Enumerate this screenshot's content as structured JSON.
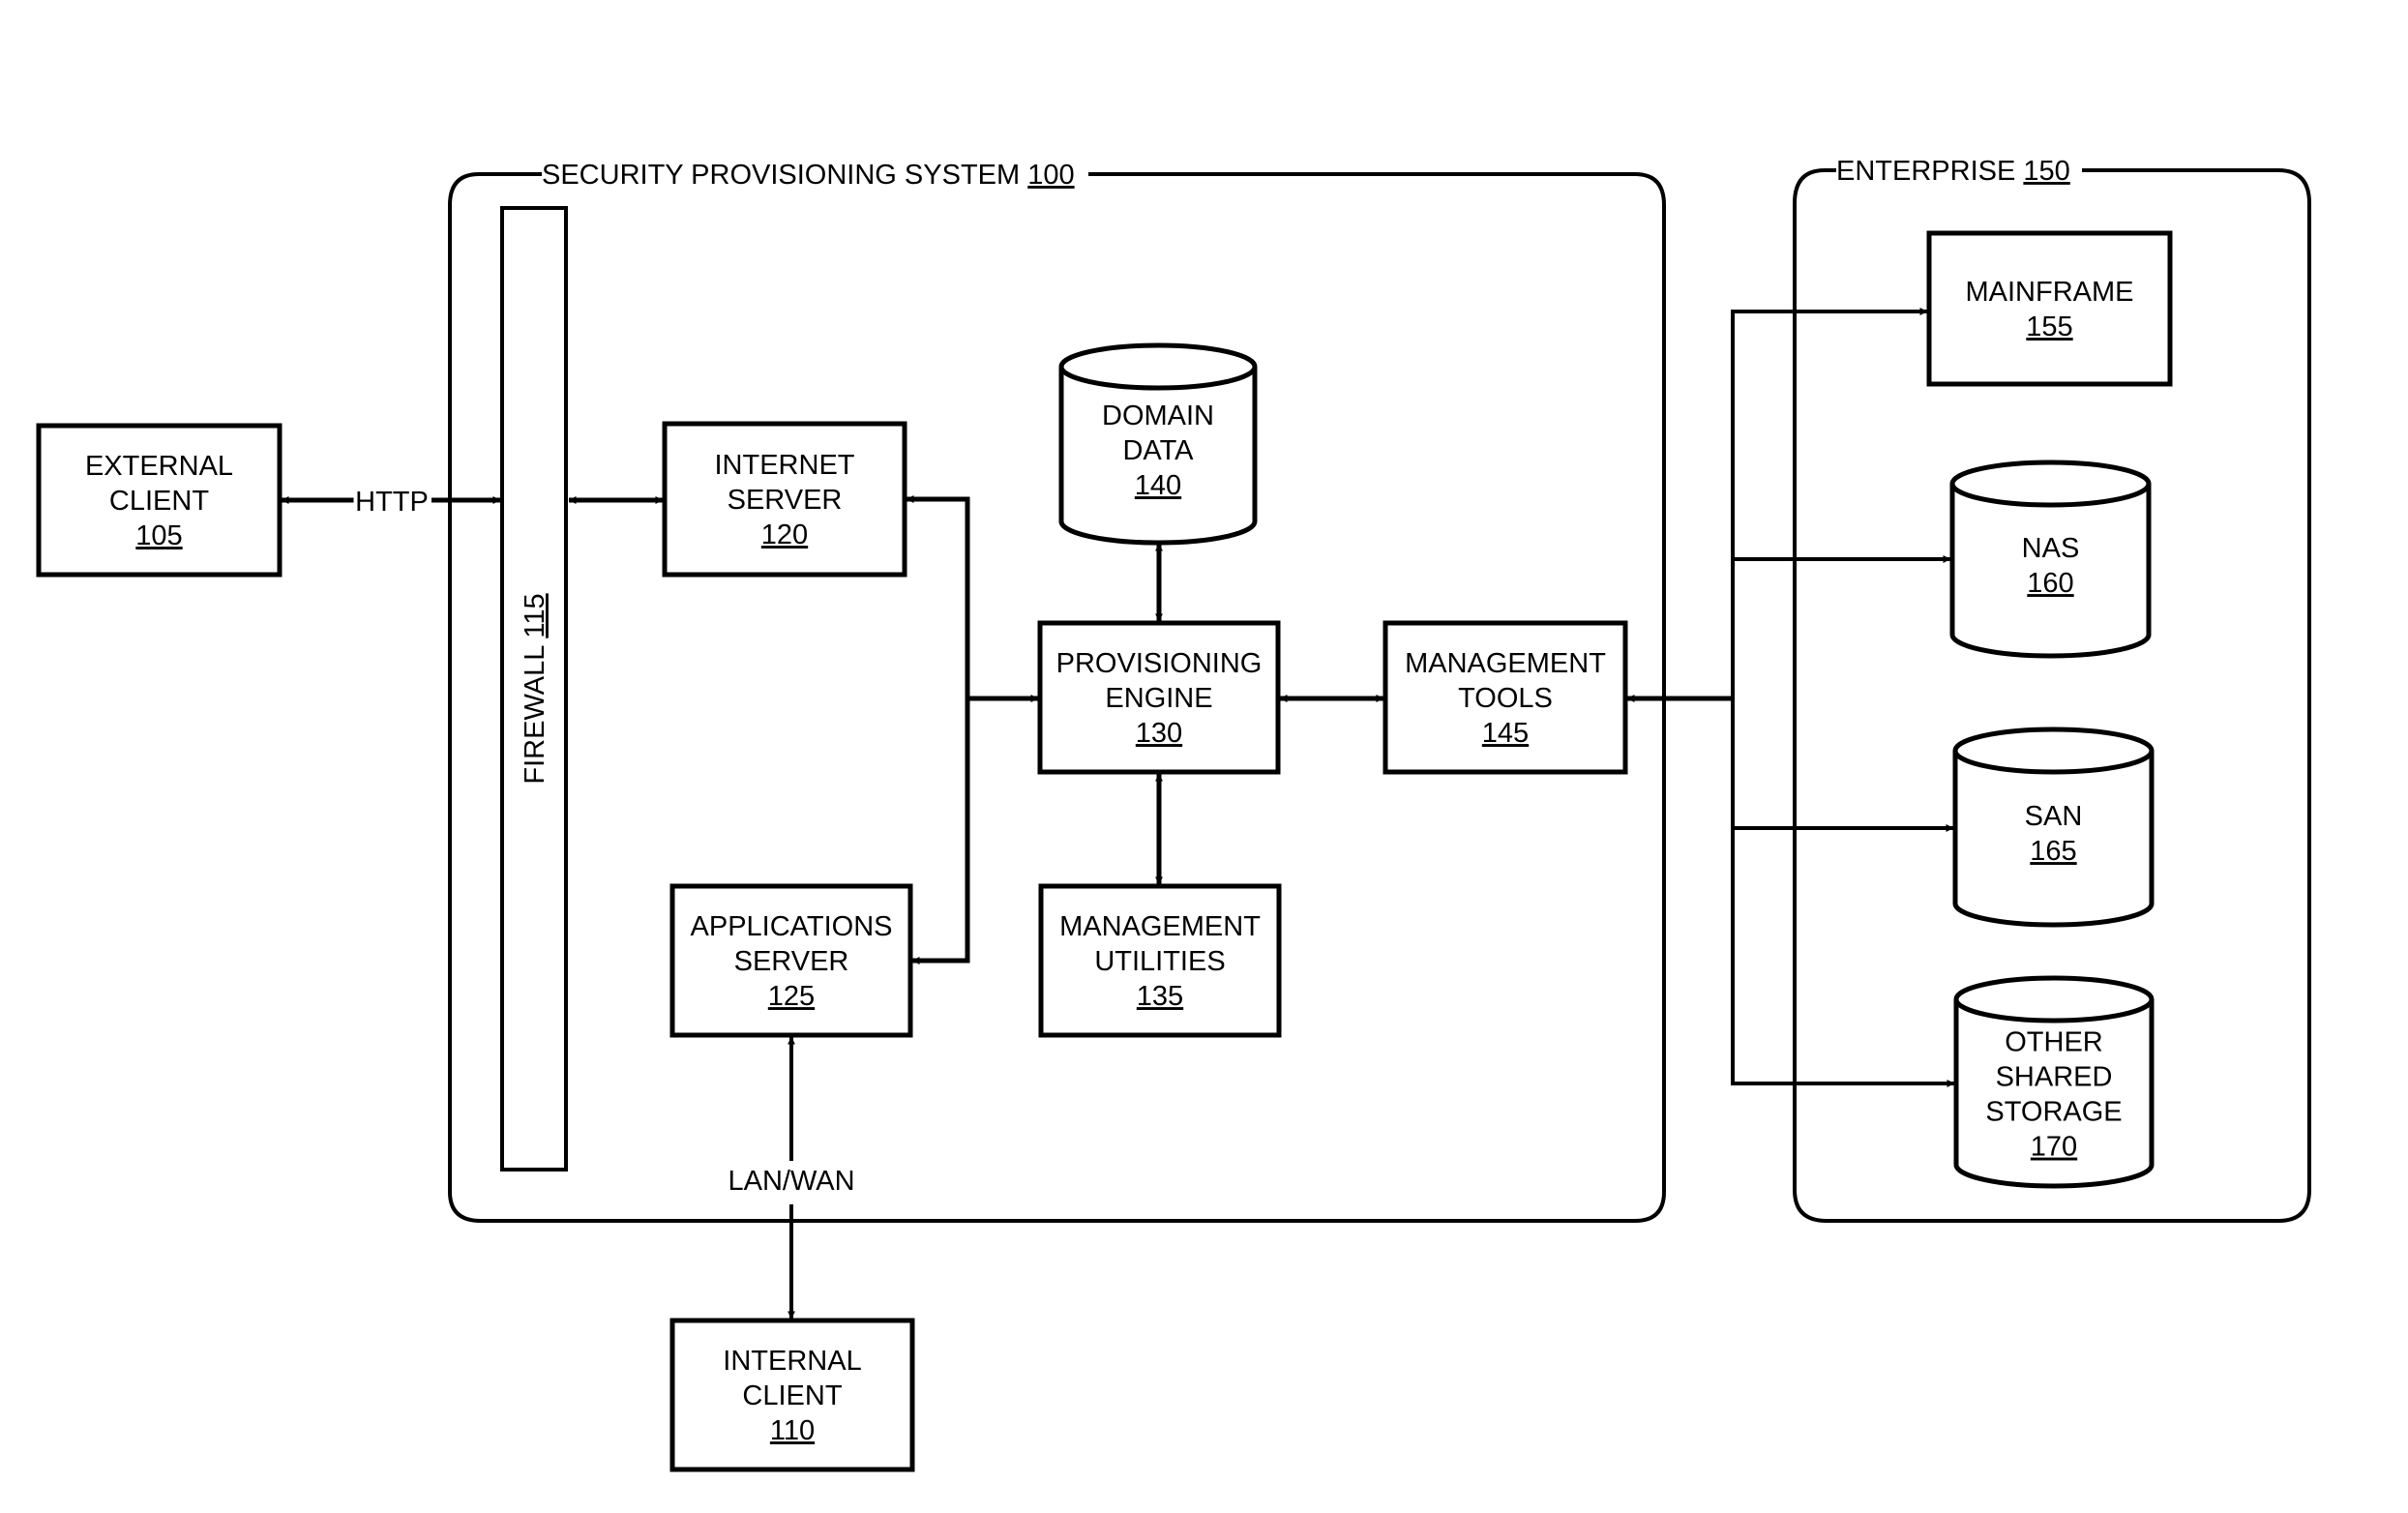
{
  "diagram": {
    "containers": {
      "security_system": {
        "label": "SECURITY PROVISIONING SYSTEM",
        "ref": "100"
      },
      "enterprise": {
        "label": "ENTERPRISE",
        "ref": "150"
      }
    },
    "nodes": {
      "external_client": {
        "lines": [
          "EXTERNAL",
          "CLIENT"
        ],
        "ref": "105"
      },
      "internal_client": {
        "lines": [
          "INTERNAL",
          "CLIENT"
        ],
        "ref": "110"
      },
      "firewall": {
        "label": "FIREWALL",
        "ref": "115"
      },
      "internet_server": {
        "lines": [
          "INTERNET",
          "SERVER"
        ],
        "ref": "120"
      },
      "applications_server": {
        "lines": [
          "APPLICATIONS",
          "SERVER"
        ],
        "ref": "125"
      },
      "provisioning_engine": {
        "lines": [
          "PROVISIONING",
          "ENGINE"
        ],
        "ref": "130"
      },
      "management_utilities": {
        "lines": [
          "MANAGEMENT",
          "UTILITIES"
        ],
        "ref": "135"
      },
      "domain_data": {
        "lines": [
          "DOMAIN",
          "DATA"
        ],
        "ref": "140"
      },
      "management_tools": {
        "lines": [
          "MANAGEMENT",
          "TOOLS"
        ],
        "ref": "145"
      },
      "mainframe": {
        "lines": [
          "MAINFRAME"
        ],
        "ref": "155"
      },
      "nas": {
        "lines": [
          "NAS"
        ],
        "ref": "160"
      },
      "san": {
        "lines": [
          "SAN"
        ],
        "ref": "165"
      },
      "other_shared_storage": {
        "lines": [
          "OTHER",
          "SHARED",
          "STORAGE"
        ],
        "ref": "170"
      }
    },
    "edge_labels": {
      "http": "HTTP",
      "lan_wan": "LAN/WAN"
    },
    "edges": [
      {
        "from": "external_client",
        "to": "firewall",
        "label": "HTTP",
        "direction": "both"
      },
      {
        "from": "firewall",
        "to": "internet_server",
        "direction": "both"
      },
      {
        "from": "provisioning_engine",
        "to": "internet_server",
        "direction": "forward"
      },
      {
        "from": "provisioning_engine",
        "to": "applications_server",
        "direction": "forward"
      },
      {
        "from": "internet_server",
        "to": "provisioning_engine",
        "direction": "forward"
      },
      {
        "from": "provisioning_engine",
        "to": "domain_data",
        "direction": "both"
      },
      {
        "from": "provisioning_engine",
        "to": "management_utilities",
        "direction": "both"
      },
      {
        "from": "provisioning_engine",
        "to": "management_tools",
        "direction": "both"
      },
      {
        "from": "enterprise_bus",
        "to": "management_tools",
        "direction": "forward"
      },
      {
        "from": "enterprise_bus",
        "to": "mainframe",
        "direction": "forward"
      },
      {
        "from": "enterprise_bus",
        "to": "nas",
        "direction": "forward"
      },
      {
        "from": "enterprise_bus",
        "to": "san",
        "direction": "forward"
      },
      {
        "from": "enterprise_bus",
        "to": "other_shared_storage",
        "direction": "forward"
      },
      {
        "from": "applications_server",
        "to": "internal_client",
        "label": "LAN/WAN",
        "direction": "both"
      }
    ]
  }
}
